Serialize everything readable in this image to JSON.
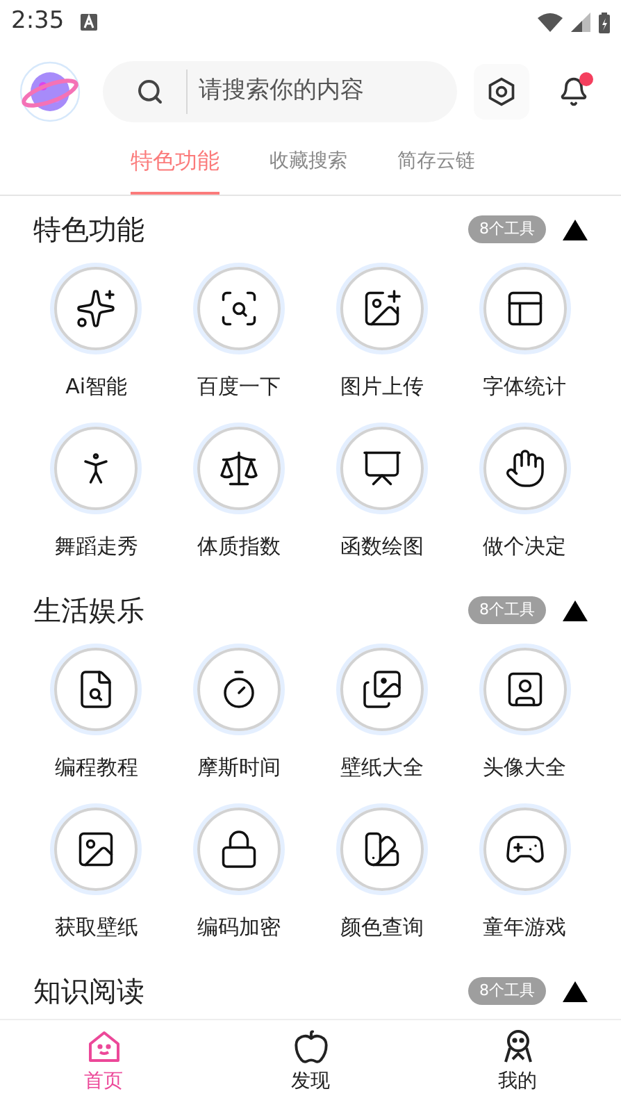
{
  "status_bar": {
    "time": "2:35"
  },
  "search": {
    "placeholder": "请搜索你的内容"
  },
  "notifications": {
    "unread": true
  },
  "tabs": [
    {
      "label": "特色功能",
      "selected": true
    },
    {
      "label": "收藏搜索",
      "selected": false
    },
    {
      "label": "简存云链",
      "selected": false
    }
  ],
  "sections": [
    {
      "title": "特色功能",
      "badge": "8个工具",
      "expanded": true,
      "items": [
        {
          "label": "Ai智能"
        },
        {
          "label": "百度一下"
        },
        {
          "label": "图片上传"
        },
        {
          "label": "字体统计"
        },
        {
          "label": "舞蹈走秀"
        },
        {
          "label": "体质指数"
        },
        {
          "label": "函数绘图"
        },
        {
          "label": "做个决定"
        }
      ]
    },
    {
      "title": "生活娱乐",
      "badge": "8个工具",
      "expanded": true,
      "items": [
        {
          "label": "编程教程"
        },
        {
          "label": "摩斯时间"
        },
        {
          "label": "壁纸大全"
        },
        {
          "label": "头像大全"
        },
        {
          "label": "获取壁纸"
        },
        {
          "label": "编码加密"
        },
        {
          "label": "颜色查询"
        },
        {
          "label": "童年游戏"
        }
      ]
    },
    {
      "title": "知识阅读",
      "badge": "8个工具",
      "expanded": true
    }
  ],
  "bottom_nav": [
    {
      "label": "首页",
      "selected": true
    },
    {
      "label": "发现",
      "selected": false
    },
    {
      "label": "我的",
      "selected": false
    }
  ]
}
